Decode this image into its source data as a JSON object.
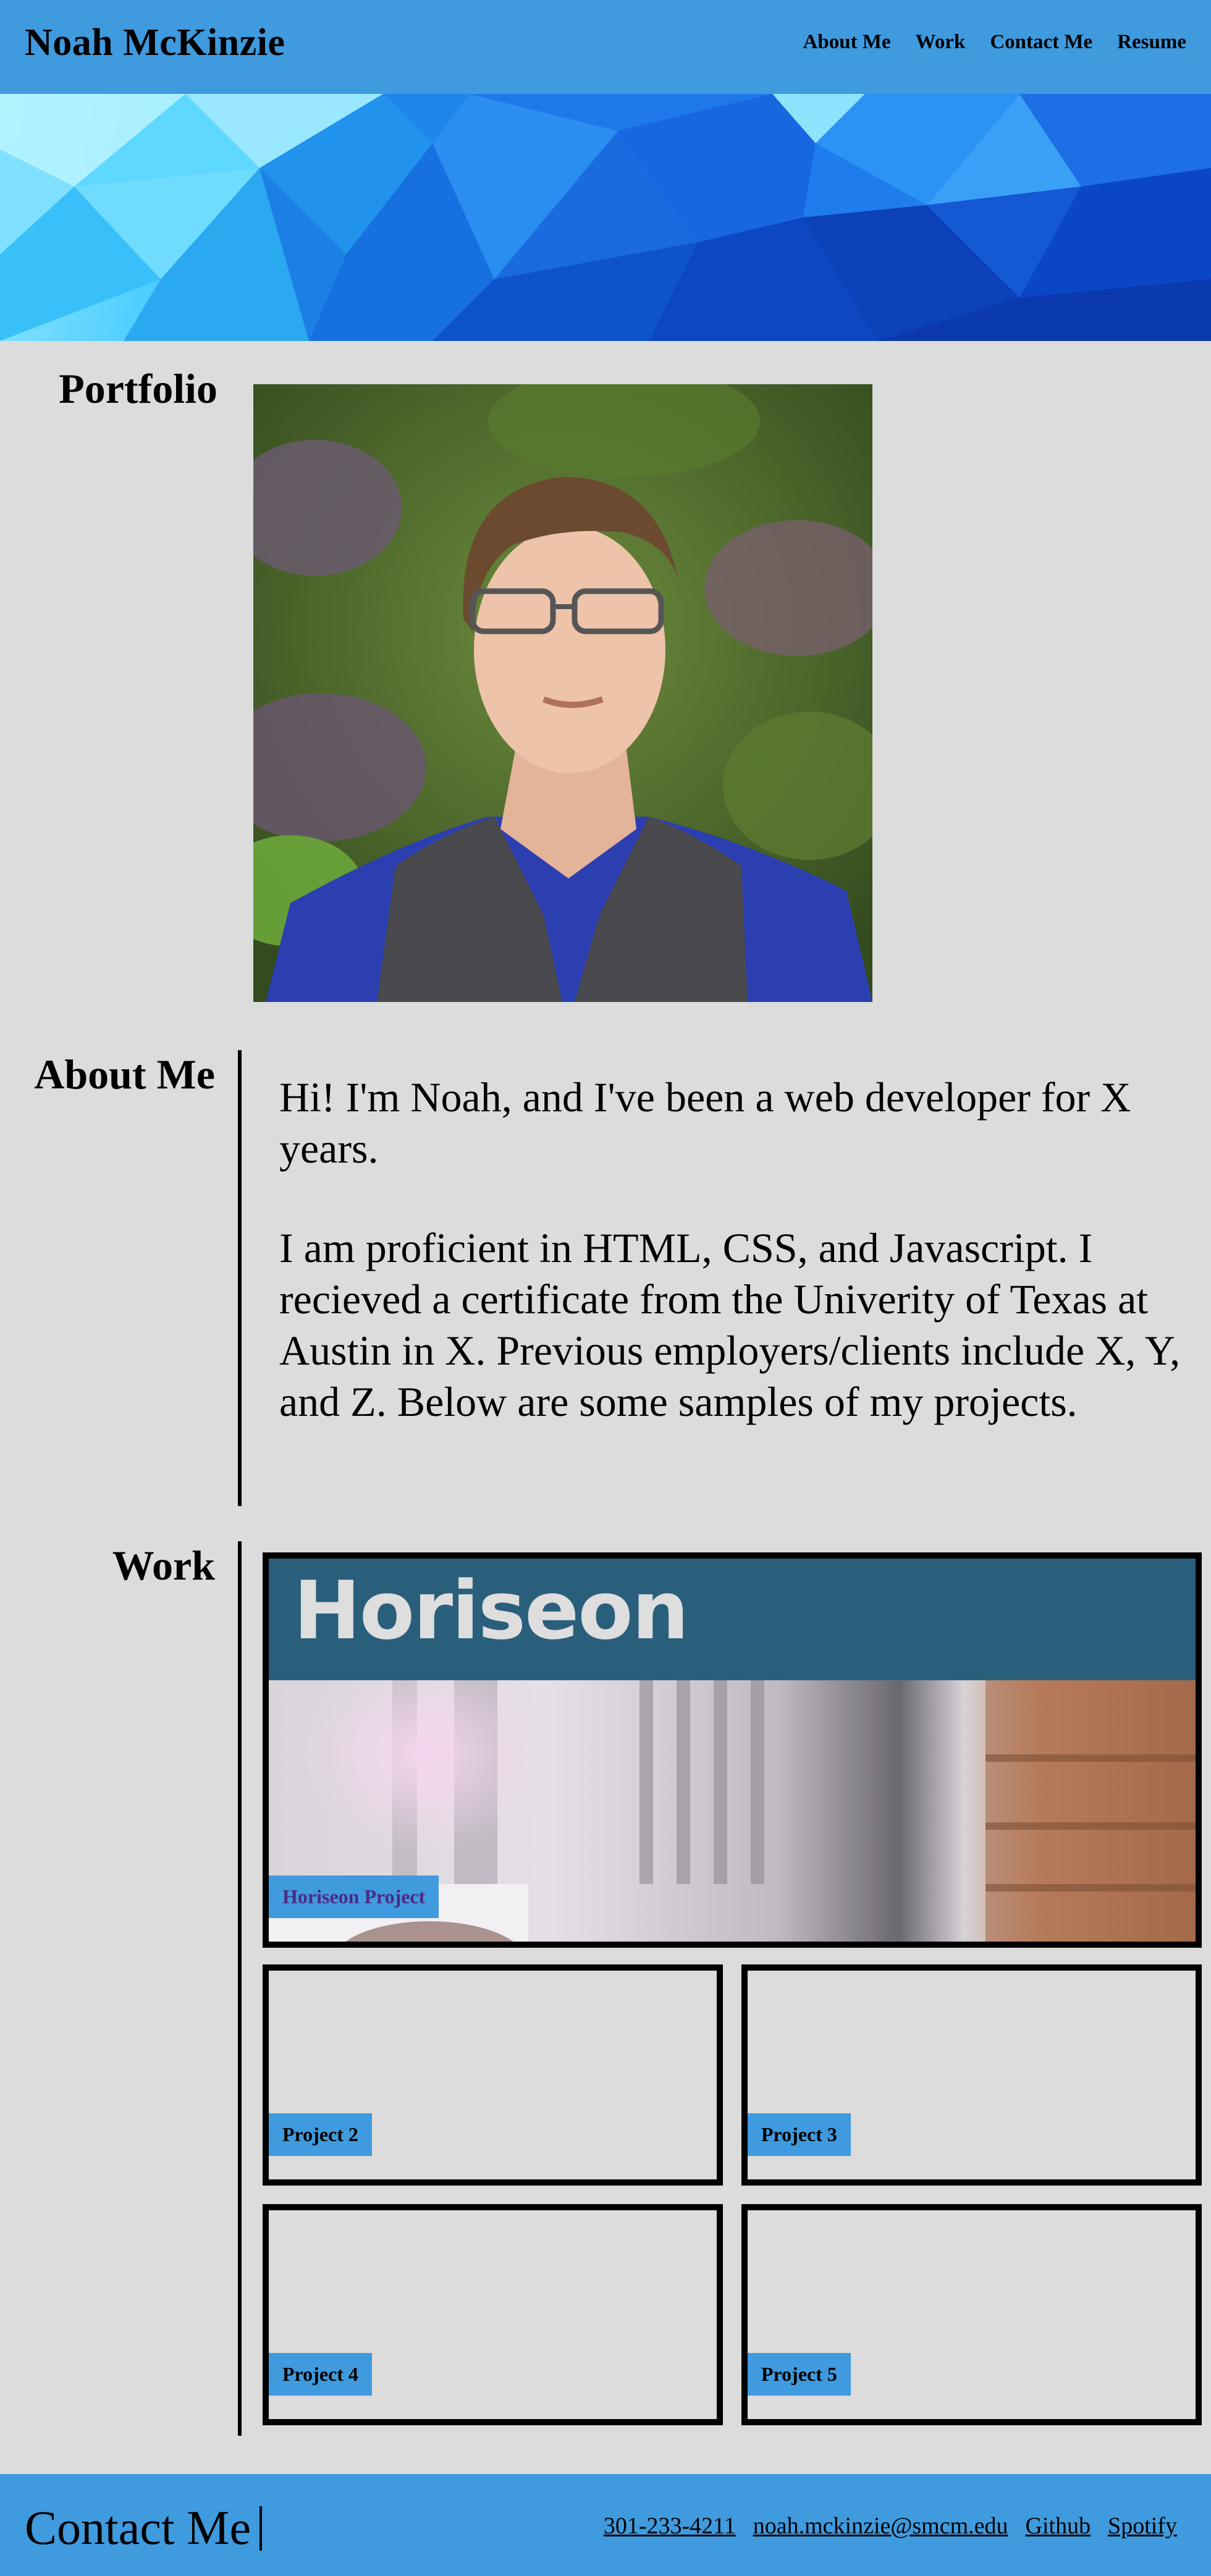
{
  "header": {
    "title": "Noah McKinzie",
    "nav": [
      "About Me",
      "Work",
      "Contact Me",
      "Resume"
    ]
  },
  "portfolio": {
    "heading": "Portfolio"
  },
  "about": {
    "heading": "About Me",
    "paragraphs": [
      "Hi! I'm Noah, and I've been a web developer for X years.",
      "I am proficient in HTML, CSS, and Javascript. I recieved a certificate from the Univerity of Texas at Austin in X. Previous employers/clients include X, Y, and Z. Below are some samples of my projects."
    ]
  },
  "work": {
    "heading": "Work",
    "featured": {
      "logo_text": "Horiseon",
      "label": "Horiseon Project"
    },
    "projects": [
      "Project 2",
      "Project 3",
      "Project 4",
      "Project 5"
    ]
  },
  "footer": {
    "heading": "Contact Me",
    "links": [
      "301-233-4211",
      "noah.mckinzie@smcm.edu",
      "Github",
      "Spotify"
    ]
  },
  "colors": {
    "header_bg": "#3f9ade",
    "page_bg": "#dcdcdc",
    "label_bg": "#3f9ade",
    "visited_link": "#4b2a86"
  }
}
